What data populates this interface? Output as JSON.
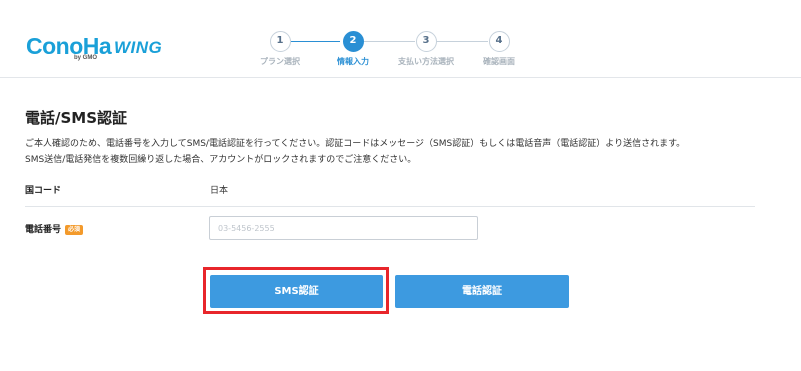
{
  "header": {
    "logo": {
      "main": "ConoHa",
      "gmo": "by GMO",
      "wing": "WING"
    },
    "steps": [
      {
        "number": "1",
        "label": "プラン選択",
        "active": false
      },
      {
        "number": "2",
        "label": "情報入力",
        "active": true
      },
      {
        "number": "3",
        "label": "支払い方法選択",
        "active": false
      },
      {
        "number": "4",
        "label": "確認画面",
        "active": false
      }
    ]
  },
  "main": {
    "title": "電話/SMS認証",
    "description_line1": "ご本人確認のため、電話番号を入力してSMS/電話認証を行ってください。認証コードはメッセージ（SMS認証）もしくは電話音声（電話認証）より送信されます。",
    "description_line2": "SMS送信/電話発信を複数回繰り返した場合、アカウントがロックされますのでご注意ください。",
    "country": {
      "label": "国コード",
      "value": "日本"
    },
    "phone": {
      "label": "電話番号",
      "required_badge": "必須",
      "value": "03-5456-2555"
    },
    "buttons": {
      "sms": "SMS認証",
      "call": "電話認証"
    }
  },
  "colors": {
    "brand": "#1aa0d8",
    "button": "#3d9ae0",
    "required": "#f39a2b",
    "highlight": "#e8262b"
  }
}
